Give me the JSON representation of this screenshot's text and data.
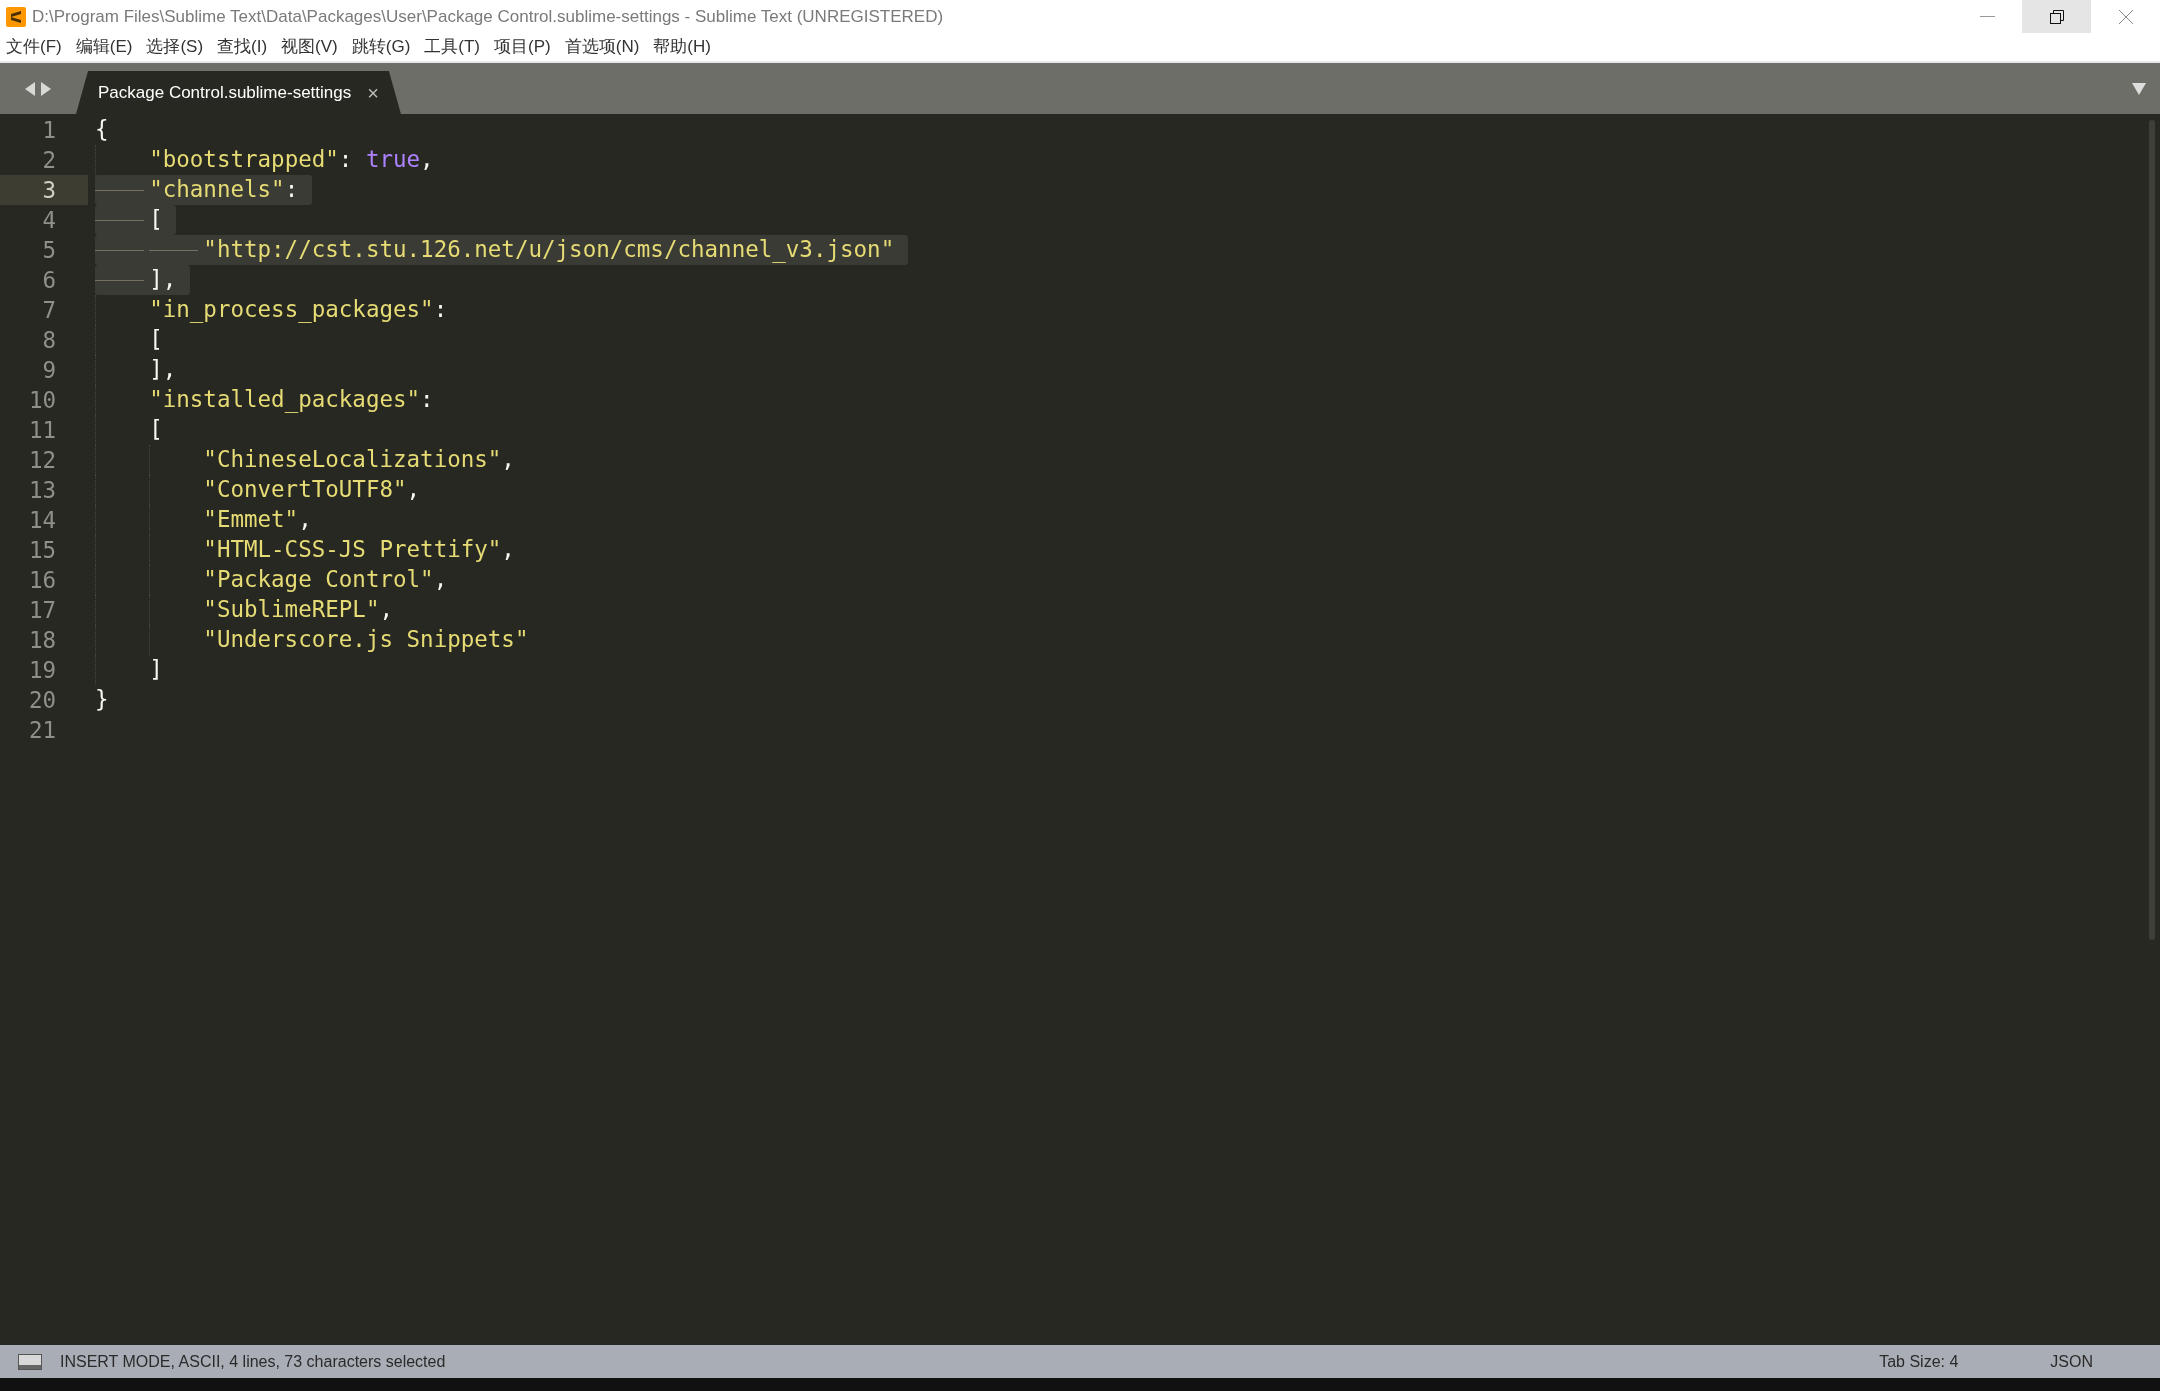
{
  "window": {
    "title": "D:\\Program Files\\Sublime Text\\Data\\Packages\\User\\Package Control.sublime-settings - Sublime Text (UNREGISTERED)"
  },
  "menu": [
    "文件(F)",
    "编辑(E)",
    "选择(S)",
    "查找(I)",
    "视图(V)",
    "跳转(G)",
    "工具(T)",
    "项目(P)",
    "首选项(N)",
    "帮助(H)"
  ],
  "tabs": [
    {
      "label": "Package Control.sublime-settings",
      "selected": true,
      "close": "×"
    }
  ],
  "editor": {
    "lines": [
      {
        "number": "1",
        "current": false,
        "selected": false,
        "tokens": [
          {
            "kind": "punct",
            "text": "{"
          }
        ]
      },
      {
        "number": "2",
        "current": false,
        "selected": false,
        "tokens": [
          {
            "kind": "tab"
          },
          {
            "kind": "string",
            "text": "\"bootstrapped\""
          },
          {
            "kind": "punct",
            "text": ": "
          },
          {
            "kind": "keyword",
            "text": "true"
          },
          {
            "kind": "punct",
            "text": ","
          }
        ]
      },
      {
        "number": "3",
        "current": true,
        "selected": true,
        "tokens": [
          {
            "kind": "tab"
          },
          {
            "kind": "string",
            "text": "\"channels\""
          },
          {
            "kind": "punct",
            "text": ":"
          }
        ]
      },
      {
        "number": "4",
        "current": false,
        "selected": true,
        "tokens": [
          {
            "kind": "tab"
          },
          {
            "kind": "punct",
            "text": "["
          }
        ]
      },
      {
        "number": "5",
        "current": false,
        "selected": true,
        "tokens": [
          {
            "kind": "tab"
          },
          {
            "kind": "tab"
          },
          {
            "kind": "string",
            "text": "\"http://cst.stu.126.net/u/json/cms/channel_v3.json\""
          }
        ]
      },
      {
        "number": "6",
        "current": false,
        "selected": true,
        "tokens": [
          {
            "kind": "tab"
          },
          {
            "kind": "punct",
            "text": "],"
          }
        ]
      },
      {
        "number": "7",
        "current": false,
        "selected": false,
        "tokens": [
          {
            "kind": "tab"
          },
          {
            "kind": "string",
            "text": "\"in_process_packages\""
          },
          {
            "kind": "punct",
            "text": ":"
          }
        ]
      },
      {
        "number": "8",
        "current": false,
        "selected": false,
        "tokens": [
          {
            "kind": "tab"
          },
          {
            "kind": "punct",
            "text": "["
          }
        ]
      },
      {
        "number": "9",
        "current": false,
        "selected": false,
        "tokens": [
          {
            "kind": "tab"
          },
          {
            "kind": "punct",
            "text": "],"
          }
        ]
      },
      {
        "number": "10",
        "current": false,
        "selected": false,
        "tokens": [
          {
            "kind": "tab"
          },
          {
            "kind": "string",
            "text": "\"installed_packages\""
          },
          {
            "kind": "punct",
            "text": ":"
          }
        ]
      },
      {
        "number": "11",
        "current": false,
        "selected": false,
        "tokens": [
          {
            "kind": "tab"
          },
          {
            "kind": "punct",
            "text": "["
          }
        ]
      },
      {
        "number": "12",
        "current": false,
        "selected": false,
        "tokens": [
          {
            "kind": "tab"
          },
          {
            "kind": "tab"
          },
          {
            "kind": "string",
            "text": "\"ChineseLocalizations\""
          },
          {
            "kind": "punct",
            "text": ","
          }
        ]
      },
      {
        "number": "13",
        "current": false,
        "selected": false,
        "tokens": [
          {
            "kind": "tab"
          },
          {
            "kind": "tab"
          },
          {
            "kind": "string",
            "text": "\"ConvertToUTF8\""
          },
          {
            "kind": "punct",
            "text": ","
          }
        ]
      },
      {
        "number": "14",
        "current": false,
        "selected": false,
        "tokens": [
          {
            "kind": "tab"
          },
          {
            "kind": "tab"
          },
          {
            "kind": "string",
            "text": "\"Emmet\""
          },
          {
            "kind": "punct",
            "text": ","
          }
        ]
      },
      {
        "number": "15",
        "current": false,
        "selected": false,
        "tokens": [
          {
            "kind": "tab"
          },
          {
            "kind": "tab"
          },
          {
            "kind": "string",
            "text": "\"HTML-CSS-JS Prettify\""
          },
          {
            "kind": "punct",
            "text": ","
          }
        ]
      },
      {
        "number": "16",
        "current": false,
        "selected": false,
        "tokens": [
          {
            "kind": "tab"
          },
          {
            "kind": "tab"
          },
          {
            "kind": "string",
            "text": "\"Package Control\""
          },
          {
            "kind": "punct",
            "text": ","
          }
        ]
      },
      {
        "number": "17",
        "current": false,
        "selected": false,
        "tokens": [
          {
            "kind": "tab"
          },
          {
            "kind": "tab"
          },
          {
            "kind": "string",
            "text": "\"SublimeREPL\""
          },
          {
            "kind": "punct",
            "text": ","
          }
        ]
      },
      {
        "number": "18",
        "current": false,
        "selected": false,
        "tokens": [
          {
            "kind": "tab"
          },
          {
            "kind": "tab"
          },
          {
            "kind": "string",
            "text": "\"Underscore.js Snippets\""
          }
        ]
      },
      {
        "number": "19",
        "current": false,
        "selected": false,
        "tokens": [
          {
            "kind": "tab"
          },
          {
            "kind": "punct",
            "text": "]"
          }
        ]
      },
      {
        "number": "20",
        "current": false,
        "selected": false,
        "tokens": [
          {
            "kind": "punct",
            "text": "}"
          }
        ]
      },
      {
        "number": "21",
        "current": false,
        "selected": false
      }
    ]
  },
  "status_bar": {
    "message": "INSERT MODE, ASCII, 4 lines, 73 characters selected",
    "tab_size": "Tab Size: 4",
    "syntax": "JSON"
  }
}
